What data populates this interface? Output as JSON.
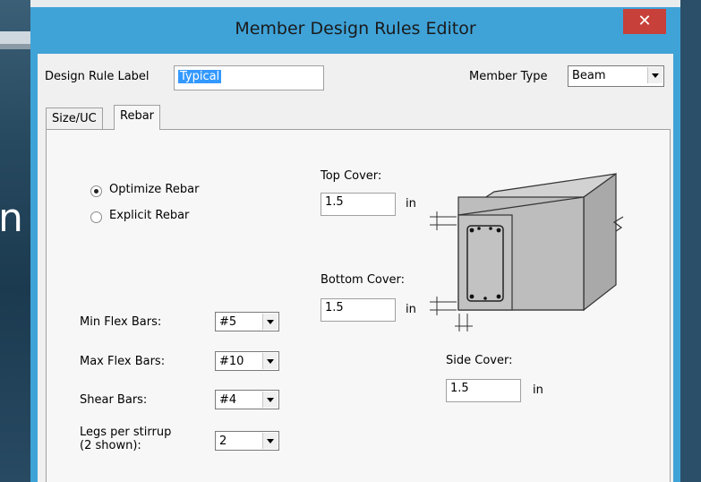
{
  "background": {
    "fragment_letter": "n"
  },
  "window": {
    "title": "Member Design Rules Editor",
    "close_glyph": "✕"
  },
  "form": {
    "design_rule_label": "Design Rule Label",
    "design_rule_value": "Typical",
    "member_type_label": "Member Type",
    "member_type_value": "Beam"
  },
  "tabs": [
    {
      "label": "Size/UC",
      "active": false
    },
    {
      "label": "Rebar",
      "active": true
    }
  ],
  "rebar": {
    "optimize_label": "Optimize Rebar",
    "explicit_label": "Explicit Rebar",
    "selected_mode": "Optimize Rebar",
    "min_flex_label": "Min Flex Bars:",
    "min_flex_value": "#5",
    "max_flex_label": "Max Flex Bars:",
    "max_flex_value": "#10",
    "shear_label": "Shear Bars:",
    "shear_value": "#4",
    "legs_label_line1": "Legs per stirrup",
    "legs_label_line2": "(2 shown):",
    "legs_value": "2",
    "top_cover_label": "Top Cover:",
    "top_cover_value": "1.5",
    "top_cover_unit": "in",
    "bottom_cover_label": "Bottom Cover:",
    "bottom_cover_value": "1.5",
    "bottom_cover_unit": "in",
    "side_cover_label": "Side Cover:",
    "side_cover_value": "1.5",
    "side_cover_unit": "in"
  },
  "colors": {
    "title_bar": "#3fa3d8",
    "close_button": "#c7403a",
    "selection": "#3399ff"
  }
}
